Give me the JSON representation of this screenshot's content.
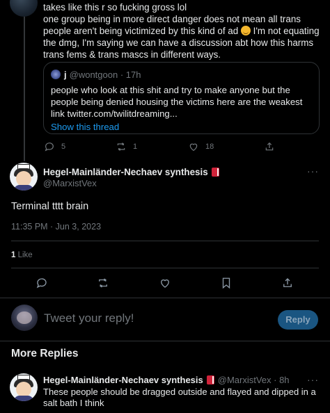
{
  "parent_tweet": {
    "line1": "takes like this r so fucking gross lol",
    "line2a": "one group being in more direct danger does not mean all trans people aren't being victimized by this kind of ad ",
    "line2b": " I'm not equating the dmg, I'm saying we can have a discussion abt how this harms trans fems & trans mascs in different ways.",
    "quote": {
      "name": "j",
      "handle": "@wontgoon · 17h",
      "body": "people who look at this shit and try to make anyone but the people being denied housing the victims here are the weakest link twitter.com/twilitdreaming...",
      "link": "Show this thread"
    },
    "actions": {
      "replies": "5",
      "retweets": "1",
      "likes": "18"
    }
  },
  "main_tweet": {
    "author": "Hegel-Mainländer-Nechaev synthesis",
    "handle": "@MarxistVex",
    "text": "Terminal tttt brain",
    "timestamp": "11:35 PM · Jun 3, 2023",
    "likes_count": "1",
    "likes_label": " Like",
    "more": "···"
  },
  "reply_box": {
    "placeholder": "Tweet your reply!",
    "button": "Reply"
  },
  "more_replies": {
    "heading": "More Replies",
    "items": [
      {
        "author": "Hegel-Mainländer-Nechaev synthesis",
        "handle": "@MarxistVex · 8h",
        "text": "These people should be dragged outside and flayed and dipped in a salt bath I think",
        "more": "···"
      }
    ]
  },
  "colors": {
    "background": "#000000",
    "text": "#e7e9ea",
    "muted": "#71767b",
    "accent": "#1d9bf0",
    "border": "#2f3336"
  },
  "icons": [
    "reply-icon",
    "retweet-icon",
    "like-icon",
    "bookmark-icon",
    "share-icon",
    "book-emoji-icon",
    "upside-down-face-emoji"
  ]
}
